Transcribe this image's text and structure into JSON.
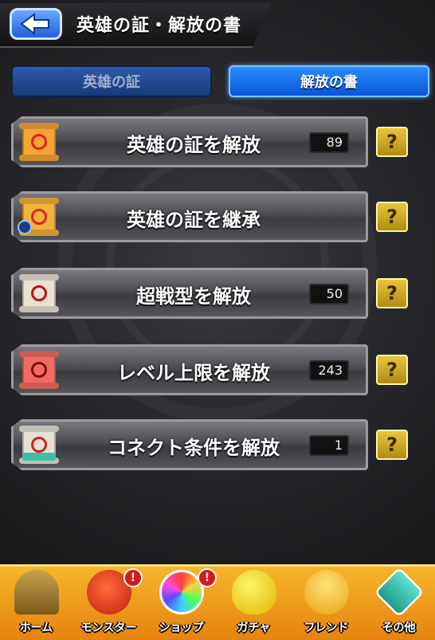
{
  "header": {
    "title": "英雄の証・解放の書"
  },
  "tabs": [
    {
      "label": "英雄の証",
      "active": false
    },
    {
      "label": "解放の書",
      "active": true
    }
  ],
  "menu": [
    {
      "label": "英雄の証を解放",
      "count": "89",
      "icon": "red-scroll-icon"
    },
    {
      "label": "英雄の証を継承",
      "count": "",
      "icon": "inherit-scroll-icon"
    },
    {
      "label": "超戦型を解放",
      "count": "50",
      "icon": "white-scroll-icon"
    },
    {
      "label": "レベル上限を解放",
      "count": "243",
      "icon": "pink-scroll-icon"
    },
    {
      "label": "コネクト条件を解放",
      "count": "1",
      "icon": "connect-scroll-icon"
    }
  ],
  "help_label": "?",
  "nav": [
    {
      "label": "ホーム",
      "icon": "home-icon",
      "badge": ""
    },
    {
      "label": "モンスター",
      "icon": "monster-icon",
      "badge": "!"
    },
    {
      "label": "ショップ",
      "icon": "rainbow-orb-icon",
      "badge": "!"
    },
    {
      "label": "ガチャ",
      "icon": "gacha-egg-icon",
      "badge": ""
    },
    {
      "label": "フレンド",
      "icon": "friend-icon",
      "badge": ""
    },
    {
      "label": "その他",
      "icon": "other-icon",
      "badge": ""
    }
  ],
  "colors": {
    "accent_blue": "#0a55d6",
    "nav_orange": "#f7b52b",
    "help_gold": "#e8c53a"
  }
}
